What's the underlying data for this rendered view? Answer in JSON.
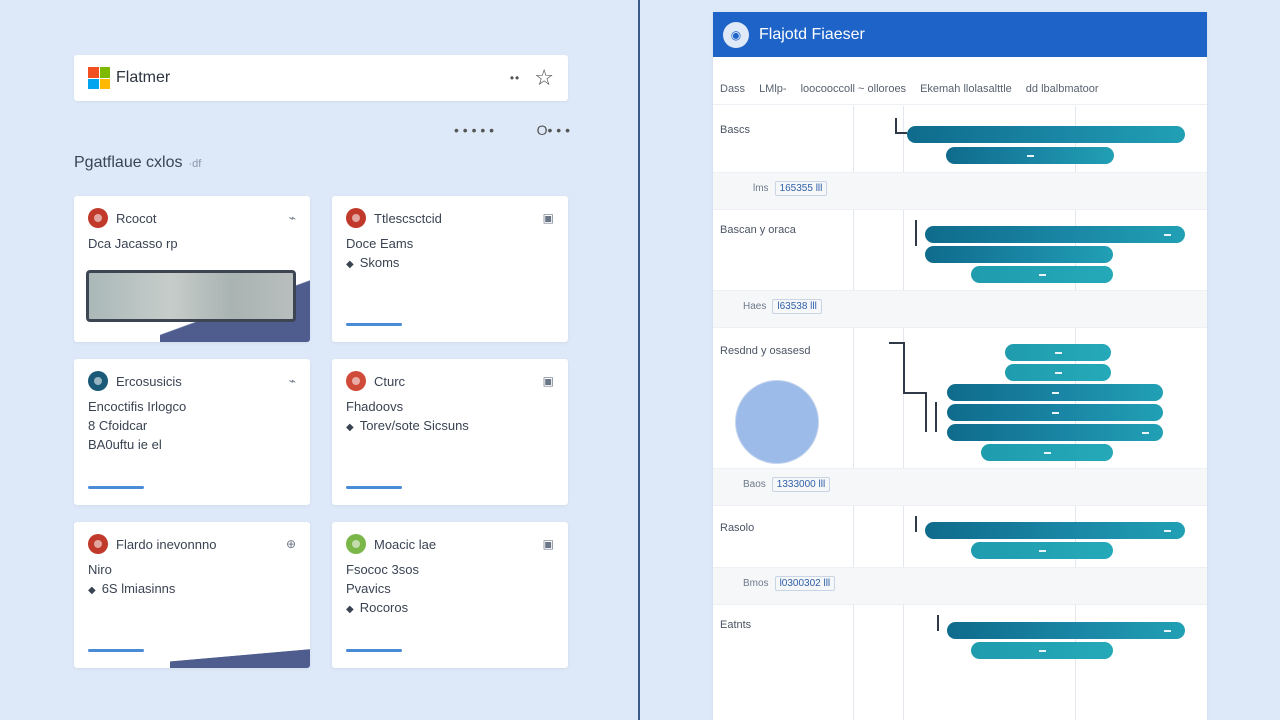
{
  "app": {
    "title": "Flatmer"
  },
  "topbar": {
    "dots": "••",
    "star_icon": "star-icon"
  },
  "toolbar": {
    "left": "• • • • •",
    "right": "O• • •"
  },
  "section": {
    "heading": "Pgatflaue cxlos",
    "sub": "·df"
  },
  "cards": [
    {
      "title": "Rcocot",
      "action": "⌁",
      "line1": "Dca  Jacasso rp",
      "line2": "",
      "line3": "",
      "icon_color": "#c0392b"
    },
    {
      "title": "Ttlescsctcid",
      "action": "▣",
      "line1": "Doce Eams",
      "line2": "Skoms",
      "line3": "",
      "icon_color": "#c0392b"
    },
    {
      "title": "Ercosusicis",
      "action": "⌁",
      "line1": "Encoctifis Irlogco",
      "line2": "8 Cfoidcar",
      "line3": "BA0uftu ie el",
      "icon_color": "#1a5a78"
    },
    {
      "title": "Cturc",
      "action": "▣",
      "line1": "Fhadoovs",
      "line2": "Torev/sote Sicsuns",
      "line3": "",
      "icon_color": "#d04a3a"
    },
    {
      "title": "Flardo inevonnno",
      "action": "⊕",
      "line1": "Niro",
      "line2": "6S lmiasinns",
      "line3": "",
      "icon_color": "#c0392b"
    },
    {
      "title": "Moacic lae",
      "action": "▣",
      "line1": "Fsococ 3sos",
      "line2": "Pvavics",
      "line3": "Rocoros",
      "icon_color": "#7ab648"
    }
  ],
  "gantt": {
    "title": "Flajotd Fiaeser",
    "columns": [
      "Dass",
      "LMlp-",
      "loocooccoll ~ olloroes",
      "Ekemah llolasalttle",
      "dd lbalbmatoor"
    ],
    "groups": [
      "Bascs",
      "Bascan y oraca",
      "Resdnd  y osasesd",
      "Rasolo",
      "Eatnts"
    ],
    "dates": [
      {
        "prefix": "lms",
        "value": "165355 lll"
      },
      {
        "prefix": "Haes",
        "value": "l63538 lll"
      },
      {
        "prefix": "Baos",
        "value": "1333000 lll"
      },
      {
        "prefix": "Bmos",
        "value": "l0300302 lll"
      }
    ]
  }
}
